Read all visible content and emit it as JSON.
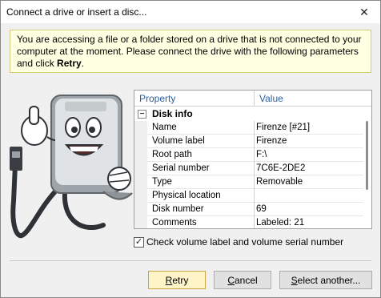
{
  "window": {
    "title": "Connect a drive or insert a disc...",
    "close_glyph": "✕"
  },
  "banner": {
    "text_before": "You are accessing a file or a folder stored on a drive that is not connected to your computer at the moment. Please connect the drive with the following parameters and click ",
    "bold_word": "Retry",
    "text_after": "."
  },
  "grid": {
    "columns": [
      "Property",
      "Value"
    ],
    "group": {
      "expander": "−",
      "label": "Disk info"
    },
    "rows": [
      {
        "key": "Name",
        "value": "Firenze [#21]"
      },
      {
        "key": "Volume label",
        "value": "Firenze"
      },
      {
        "key": "Root path",
        "value": "F:\\"
      },
      {
        "key": "Serial number",
        "value": "7C6E-2DE2"
      },
      {
        "key": "Type",
        "value": "Removable"
      },
      {
        "key": "Physical location",
        "value": ""
      },
      {
        "key": "Disk number",
        "value": "69"
      },
      {
        "key": "Comments",
        "value": "Labeled: 21"
      }
    ]
  },
  "checkbox": {
    "checked": true,
    "mark": "✓",
    "label": "Check volume label and volume serial number"
  },
  "buttons": {
    "retry": {
      "mnemonic": "R",
      "rest": "etry"
    },
    "cancel": {
      "mnemonic": "C",
      "rest": "ancel"
    },
    "select": {
      "mnemonic": "S",
      "rest": "elect another..."
    }
  }
}
